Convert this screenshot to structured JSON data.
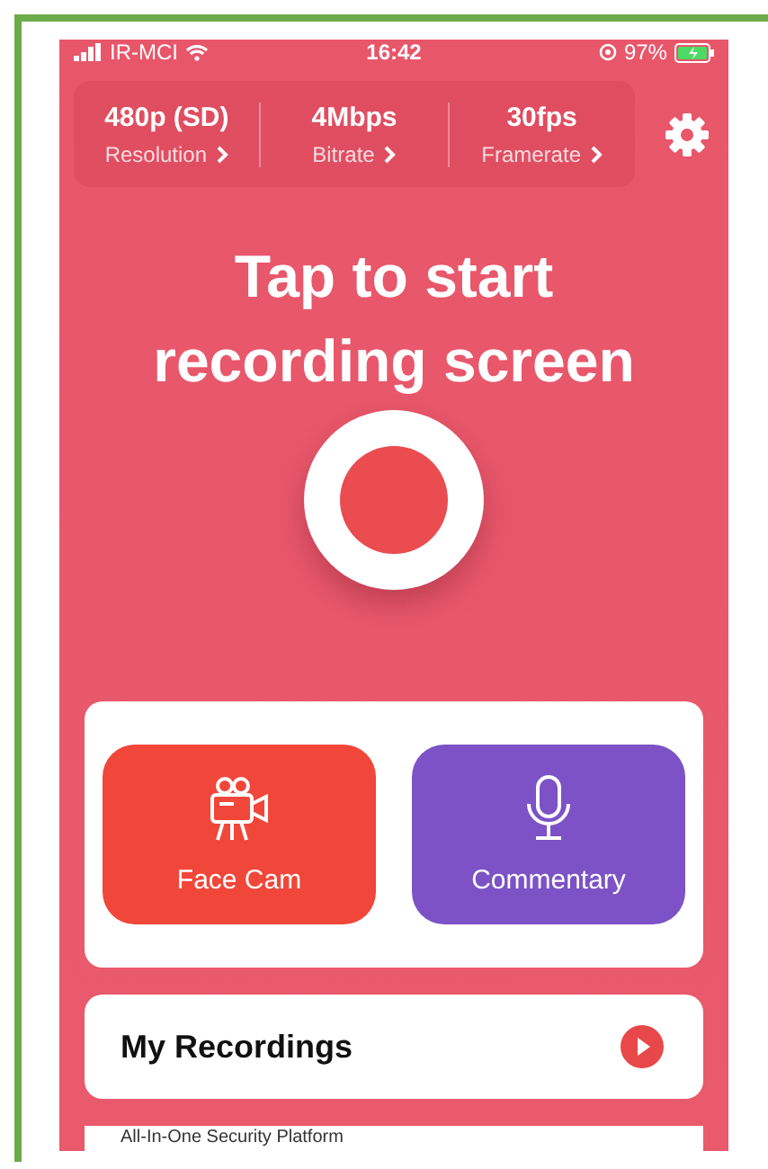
{
  "status_bar": {
    "carrier": "IR-MCI",
    "time": "16:42",
    "battery": "97%"
  },
  "settings": [
    {
      "value": "480p (SD)",
      "label": "Resolution"
    },
    {
      "value": "4Mbps",
      "label": "Bitrate"
    },
    {
      "value": "30fps",
      "label": "Framerate"
    }
  ],
  "title": "Tap to start recording screen",
  "actions": [
    {
      "label": "Face Cam",
      "kind": "facecam",
      "color": "#f0473a"
    },
    {
      "label": "Commentary",
      "kind": "commentary",
      "color": "#7c52c6"
    }
  ],
  "recordings": {
    "title": "My Recordings"
  },
  "ad": {
    "text": "All-In-One Security Platform"
  }
}
